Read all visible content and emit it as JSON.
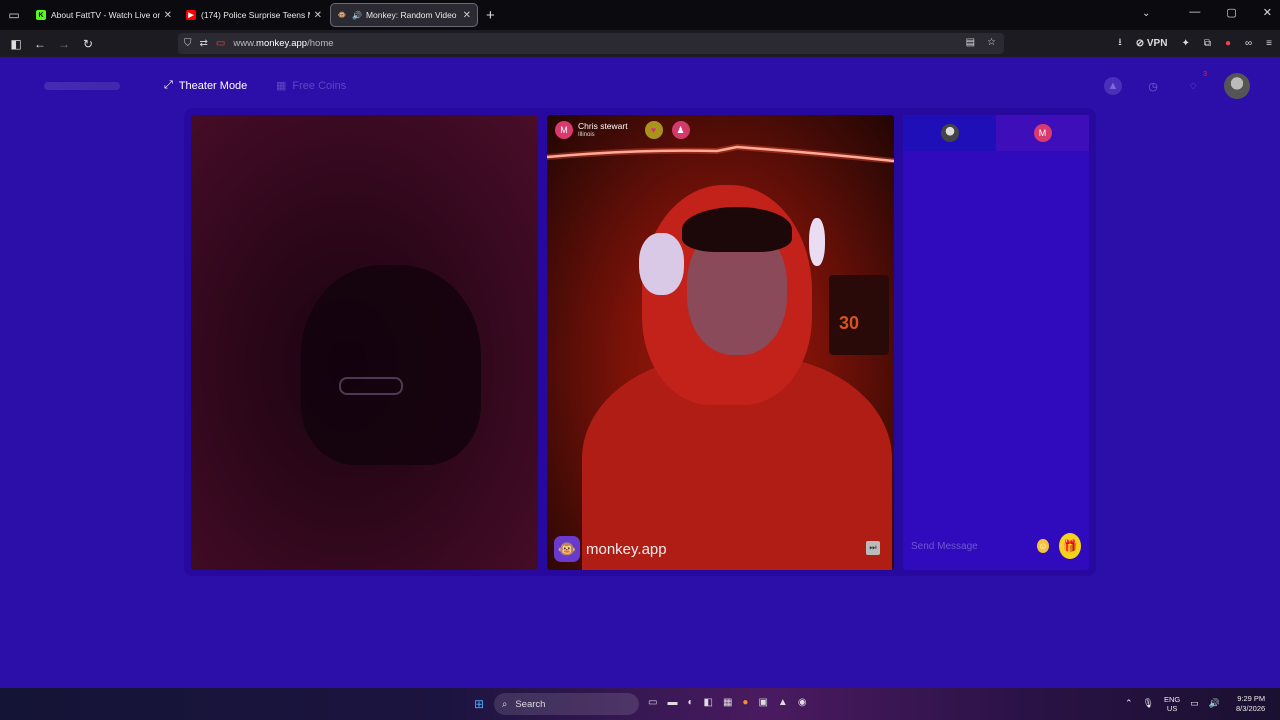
{
  "browser": {
    "tabs": [
      {
        "title": "About FattTV - Watch Live on K",
        "favicon": "K",
        "favicon_color": "#53fc18",
        "active": false
      },
      {
        "title": "(174) Police Surprise Teens Min:",
        "favicon": "▶",
        "favicon_color": "#ff0000",
        "active": false
      },
      {
        "title": "Monkey: Random Video Ch",
        "favicon": "🐵",
        "favicon_color": "#c69c5d",
        "active": true,
        "audio": "🔊"
      }
    ],
    "url_prefix": "www.",
    "url_host": "monkey.app",
    "url_path": "/home",
    "vpn_label": "VPN"
  },
  "header": {
    "theater_label": "Theater Mode",
    "free_coins_label": "Free Coins",
    "notif_count": "3"
  },
  "peer": {
    "initial": "M",
    "name": "Chris stewart",
    "location": "Illinois"
  },
  "jersey_number": "30",
  "watermark": "monkey.app",
  "chat": {
    "tab_initial": "M",
    "placeholder": "Send Message"
  },
  "taskbar": {
    "search_label": "Search",
    "lang_top": "ENG",
    "lang_bottom": "US",
    "time": "9:29 PM",
    "date": "8/3/2026"
  },
  "colors": {
    "page_bg": "#2b0fa8",
    "accent_pink": "#d83a6e",
    "gift_yellow": "#f6d21c"
  }
}
